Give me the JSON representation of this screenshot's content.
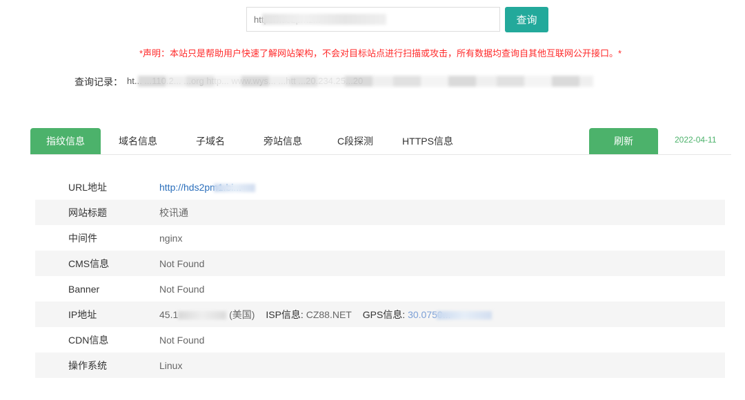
{
  "search": {
    "value": "http://hds2pm1...",
    "query_button": "查询"
  },
  "disclaimer": "*声明：本站只是帮助用户快速了解网站架构，不会对目标站点进行扫描或攻击，所有数据均查询自其他互联网公开接口。*",
  "history": {
    "label": "查询记录：",
    "text": "ht... ...110.2...  ...org http... www.wys...  ...htt ...20.234.25...20"
  },
  "tabs": [
    {
      "label": "指纹信息",
      "active": true
    },
    {
      "label": "域名信息"
    },
    {
      "label": "子域名"
    },
    {
      "label": "旁站信息"
    },
    {
      "label": "C段探测"
    },
    {
      "label": "HTTPS信息"
    }
  ],
  "refresh_button": "刷新",
  "date": "2022-04-11",
  "info": {
    "url": {
      "key": "URL地址",
      "value": "http://hds2pm1.bi..."
    },
    "title": {
      "key": "网站标题",
      "value": "校讯通"
    },
    "middleware": {
      "key": "中间件",
      "value": "nginx"
    },
    "cms": {
      "key": "CMS信息",
      "value": "Not Found"
    },
    "banner": {
      "key": "Banner",
      "value": "Not Found"
    },
    "ip": {
      "key": "IP地址",
      "value": "45.1",
      "country": "(美国)",
      "isp_label": "ISP信息:",
      "isp_value": "CZ88.NET",
      "gps_label": "GPS信息:",
      "gps_value": "30.0750..."
    },
    "cdn": {
      "key": "CDN信息",
      "value": "Not Found"
    },
    "os": {
      "key": "操作系统",
      "value": "Linux"
    }
  },
  "colors": {
    "primary_teal": "#23a99b",
    "primary_green": "#4cb26b",
    "warning_red": "#ff2a2a",
    "link_blue": "#2a6ebb"
  }
}
